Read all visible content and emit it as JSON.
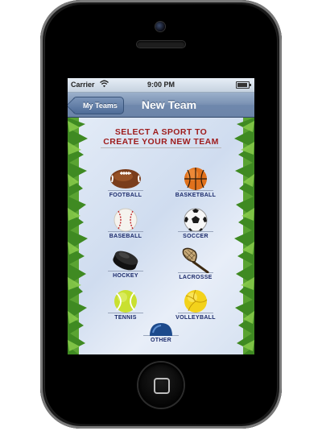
{
  "status_bar": {
    "carrier": "Carrier",
    "time": "9:00 PM",
    "battery_level": 0.9
  },
  "nav": {
    "back_label": "My Teams",
    "title": "New Team"
  },
  "prompt": {
    "line1": "SELECT A SPORT TO",
    "line2": "CREATE YOUR NEW TEAM"
  },
  "sports": [
    {
      "label": "FOOTBALL",
      "icon": "football-icon"
    },
    {
      "label": "BASKETBALL",
      "icon": "basketball-icon"
    },
    {
      "label": "BASEBALL",
      "icon": "baseball-icon"
    },
    {
      "label": "SOCCER",
      "icon": "soccer-ball-icon"
    },
    {
      "label": "HOCKEY",
      "icon": "hockey-puck-icon"
    },
    {
      "label": "LACROSSE",
      "icon": "lacrosse-stick-icon"
    },
    {
      "label": "TENNIS",
      "icon": "tennis-ball-icon"
    },
    {
      "label": "VOLLEYBALL",
      "icon": "volleyball-icon"
    },
    {
      "label": "OTHER",
      "icon": "helmet-icon"
    }
  ],
  "colors": {
    "headline": "#9e1b1b",
    "label": "#1b2a6b",
    "nav": "#6f88ad",
    "grass": "#4f9a2c"
  }
}
